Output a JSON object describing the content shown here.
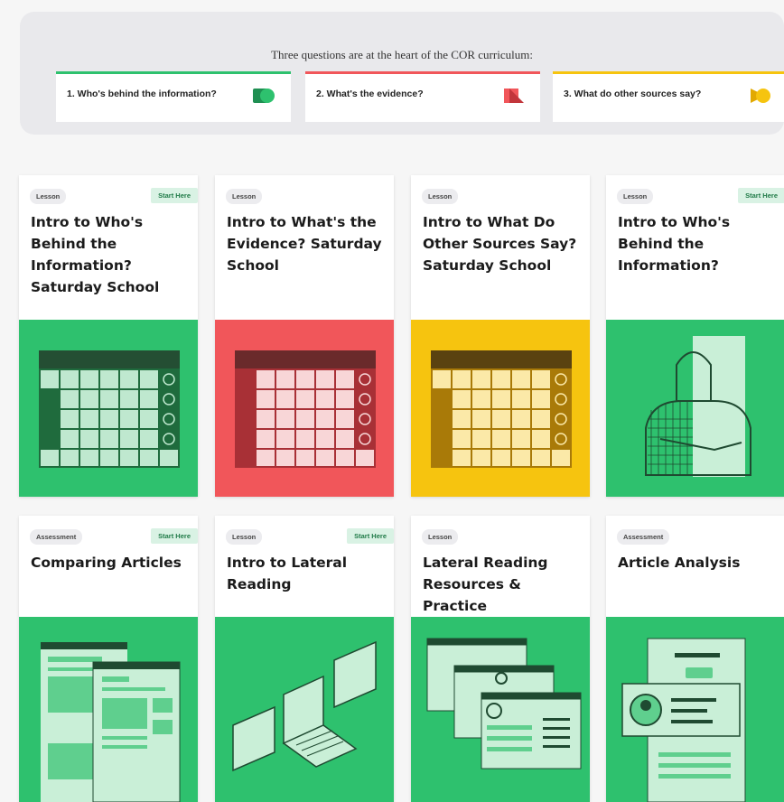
{
  "header": {
    "intro": "Three questions are at the heart of the COR curriculum:",
    "questions": [
      {
        "label": "1. Who's behind the information?",
        "color": "#2ec16e",
        "icon": "green-shapes-icon"
      },
      {
        "label": "2. What's the evidence?",
        "color": "#f1565a",
        "icon": "red-shapes-icon"
      },
      {
        "label": "3. What do other sources say?",
        "color": "#f6c40f",
        "icon": "yellow-shapes-icon"
      }
    ]
  },
  "cards": [
    {
      "type": "Lesson",
      "start": "Start Here",
      "title": "Intro to Who's Behind the Information? Saturday School",
      "art": "calendar-green",
      "bg": "#2ec16e"
    },
    {
      "type": "Lesson",
      "start": "",
      "title": "Intro to What's the Evidence? Saturday School",
      "art": "calendar-red",
      "bg": "#f1565a"
    },
    {
      "type": "Lesson",
      "start": "",
      "title": "Intro to What Do Other Sources Say? Saturday School",
      "art": "calendar-yellow",
      "bg": "#f6c40f"
    },
    {
      "type": "Lesson",
      "start": "Start Here",
      "title": "Intro to Who's Behind the Information?",
      "art": "person-illustration",
      "bg": "#2ec16e"
    },
    {
      "type": "Assessment",
      "start": "Start Here",
      "title": "Comparing Articles",
      "art": "articles-illustration",
      "bg": "#2ec16e"
    },
    {
      "type": "Lesson",
      "start": "Start Here",
      "title": "Intro to Lateral Reading",
      "art": "laptop-windows-illustration",
      "bg": "#2ec16e"
    },
    {
      "type": "Lesson",
      "start": "",
      "title": "Lateral Reading Resources & Practice",
      "art": "browser-windows-illustration",
      "bg": "#2ec16e"
    },
    {
      "type": "Assessment",
      "start": "",
      "title": "Article Analysis",
      "art": "document-profile-illustration",
      "bg": "#2ec16e"
    }
  ]
}
